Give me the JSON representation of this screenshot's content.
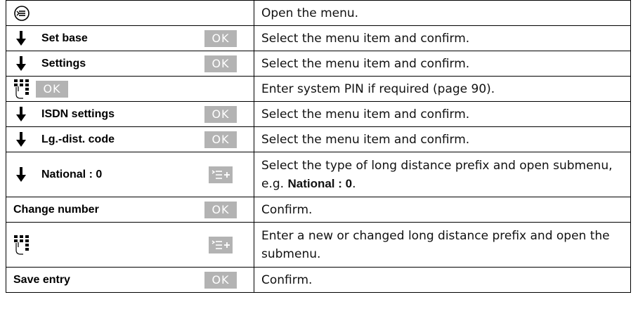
{
  "rows": [
    {
      "control": {
        "icon": "menu-key-icon"
      },
      "description": "Open the menu."
    },
    {
      "control": {
        "icon": "down-arrow-icon",
        "label": "Set base",
        "key": "OK"
      },
      "description": "Select the menu item and confirm."
    },
    {
      "control": {
        "icon": "down-arrow-icon",
        "label": "Settings",
        "key": "OK"
      },
      "description": "Select the menu item and confirm."
    },
    {
      "control": {
        "icon": "keypad-icon",
        "key": "OK"
      },
      "description": "Enter system PIN if required (page 90)."
    },
    {
      "control": {
        "icon": "down-arrow-icon",
        "label": "ISDN settings",
        "key": "OK"
      },
      "description": "Select the menu item and confirm."
    },
    {
      "control": {
        "icon": "down-arrow-icon",
        "label": "Lg.-dist. code",
        "key": "OK"
      },
      "description": "Select the menu item and confirm."
    },
    {
      "control": {
        "icon": "down-arrow-icon",
        "label": "National : 0",
        "key_icon": "submenu-key-icon"
      },
      "description": "Select the type of long distance prefix and open submenu, e.g. ",
      "description_bold": "National : 0",
      "description_end": "."
    },
    {
      "control": {
        "label": "Change number",
        "key": "OK"
      },
      "description": "Confirm."
    },
    {
      "control": {
        "icon": "keypad-icon",
        "key_icon": "submenu-key-icon"
      },
      "description": "Enter a new or changed long distance prefix and open the submenu."
    },
    {
      "control": {
        "label": "Save entry",
        "key": "OK"
      },
      "description": "Confirm."
    }
  ],
  "colors": {
    "softkey_bg": "#b3b3b3",
    "softkey_text": "#ffffff",
    "border": "#000000"
  }
}
